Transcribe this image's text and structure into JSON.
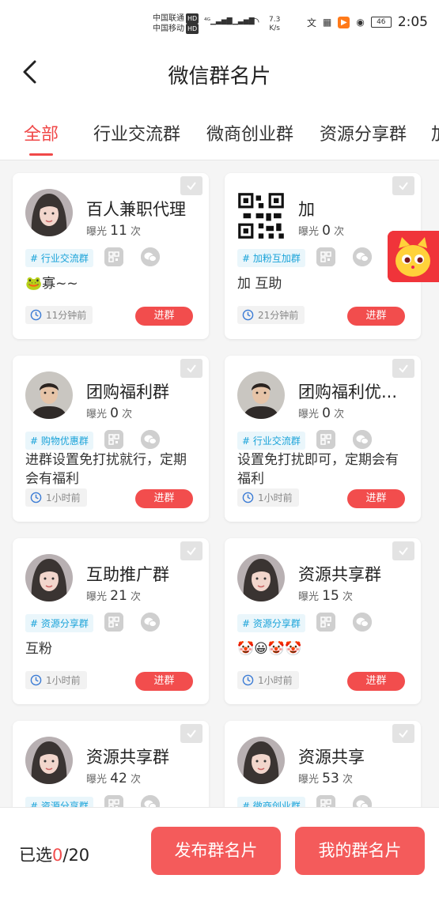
{
  "status_bar": {
    "carrier1": "中国联通",
    "carrier2": "中国移动",
    "hd": "HD",
    "net_speed_value": "7.3",
    "net_speed_unit": "K/s",
    "battery": "46",
    "time": "2:05"
  },
  "header": {
    "title": "微信群名片"
  },
  "tabs": [
    {
      "label": "全部",
      "active": true
    },
    {
      "label": "行业交流群"
    },
    {
      "label": "微商创业群"
    },
    {
      "label": "资源分享群"
    },
    {
      "label": "加"
    }
  ],
  "cards": [
    {
      "name": "百人兼职代理",
      "exposure_label": "曝光",
      "exposure": "11",
      "exposure_unit": "次",
      "tag": "# 行业交流群",
      "desc": "🐸寡~~",
      "time": "11分钟前",
      "join": "进群",
      "avatar": "woman"
    },
    {
      "name": "加",
      "exposure_label": "曝光",
      "exposure": "0",
      "exposure_unit": "次",
      "tag": "# 加粉互加群",
      "desc": "加  互助",
      "time": "21分钟前",
      "join": "进群",
      "avatar": "qr"
    },
    {
      "name": "团购福利群",
      "exposure_label": "曝光",
      "exposure": "0",
      "exposure_unit": "次",
      "tag": "# 购物优惠群",
      "desc": "进群设置免打扰就行，定期会有福利",
      "time": "1小时前",
      "join": "进群",
      "avatar": "man"
    },
    {
      "name": "团购福利优...",
      "exposure_label": "曝光",
      "exposure": "0",
      "exposure_unit": "次",
      "tag": "# 行业交流群",
      "desc": "设置免打扰即可，定期会有福利",
      "time": "1小时前",
      "join": "进群",
      "avatar": "man"
    },
    {
      "name": "互助推广群",
      "exposure_label": "曝光",
      "exposure": "21",
      "exposure_unit": "次",
      "tag": "# 资源分享群",
      "desc": "互粉",
      "time": "1小时前",
      "join": "进群",
      "avatar": "woman"
    },
    {
      "name": "资源共享群",
      "exposure_label": "曝光",
      "exposure": "15",
      "exposure_unit": "次",
      "tag": "# 资源分享群",
      "desc": "🤡😀🤡🤡",
      "time": "1小时前",
      "join": "进群",
      "avatar": "woman"
    },
    {
      "name": "资源共享群",
      "exposure_label": "曝光",
      "exposure": "42",
      "exposure_unit": "次",
      "tag": "# 资源分享群",
      "desc": "",
      "time": "",
      "join": "",
      "avatar": "woman"
    },
    {
      "name": "资源共享",
      "exposure_label": "曝光",
      "exposure": "53",
      "exposure_unit": "次",
      "tag": "# 微商创业群",
      "desc": "",
      "time": "",
      "join": "",
      "avatar": "woman"
    }
  ],
  "bottom": {
    "selected_prefix": "已选",
    "selected_count": "0",
    "selected_total": "/20",
    "publish_button": "发布群名片",
    "my_cards_button": "我的群名片"
  },
  "colors": {
    "accent": "#f24d4d",
    "tag_text": "#1aa3d9",
    "tag_bg": "#eaf6fb"
  }
}
